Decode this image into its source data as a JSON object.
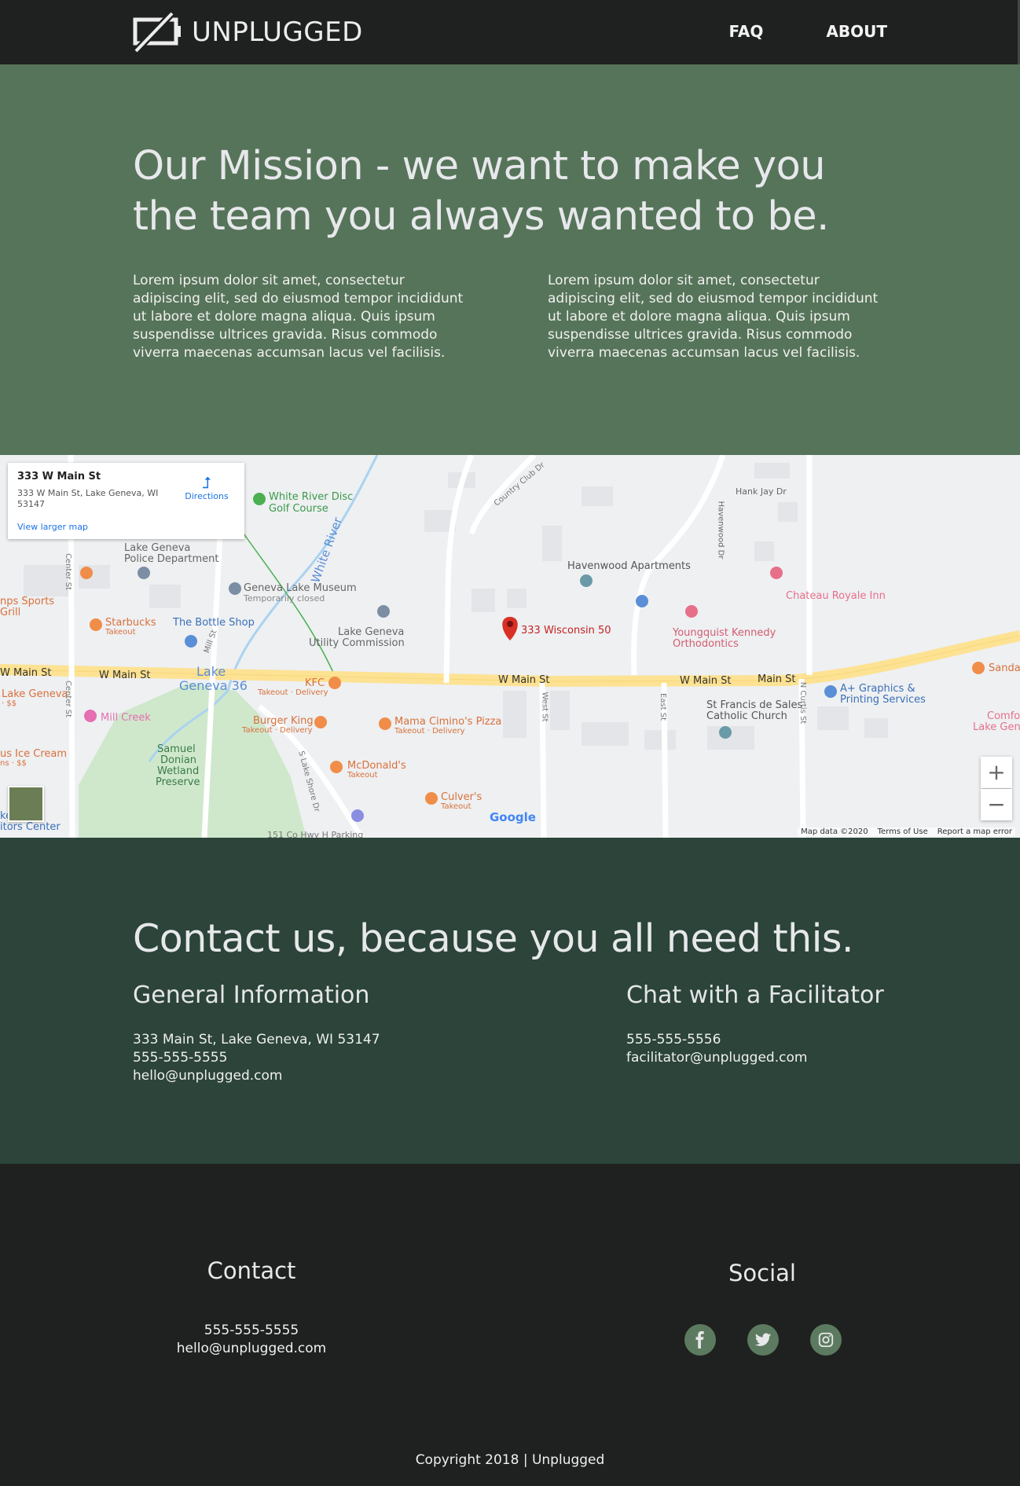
{
  "nav": {
    "brand": "UNPLUGGED",
    "links": [
      "FAQ",
      "ABOUT"
    ]
  },
  "mission": {
    "heading": "Our Mission - we want to make you the team you always wanted to be.",
    "paragraphs": [
      "Lorem ipsum dolor sit amet, consectetur adipiscing elit, sed do eiusmod tempor incididunt ut labore et dolore magna aliqua. Quis ipsum suspendisse ultrices gravida. Risus commodo viverra maecenas accumsan lacus vel facilisis.",
      "Lorem ipsum dolor sit amet, consectetur adipiscing elit, sed do eiusmod tempor incididunt ut labore et dolore magna aliqua. Quis ipsum suspendisse ultrices gravida. Risus commodo viverra maecenas accumsan lacus vel facilisis."
    ]
  },
  "map": {
    "card_title": "333 W Main St",
    "card_address": "333 W Main St, Lake Geneva, WI 53147",
    "directions": "Directions",
    "view_larger": "View larger map",
    "marker_label": "333 Wisconsin 50",
    "zoom_in": "+",
    "zoom_out": "−",
    "google": "Google",
    "footer": [
      "Map data ©2020",
      "Terms of Use",
      "Report a map error"
    ],
    "labels": {
      "white_river_disc": "White River Disc",
      "golf_course": "Golf Course",
      "country_club_dr": "Country Club Dr",
      "hank_jay_dr": "Hank Jay Dr",
      "havenwood_dr": "Havenwood Dr",
      "lake_geneva_police_1": "Lake Geneva",
      "lake_geneva_police_2": "Police Department",
      "white_river": "White River",
      "havenwood_apartments": "Havenwood Apartments",
      "chateau_royale": "Chateau Royale Inn",
      "geneva_lake_museum": "Geneva Lake Museum",
      "temporarily_closed": "Temporarily closed",
      "sports_grill_1": "nps Sports",
      "sports_grill_2": "Grill",
      "starbucks": "Starbucks",
      "takeout": "Takeout",
      "bottle_shop": "The Bottle Shop",
      "utility_1": "Lake Geneva",
      "utility_2": "Utility Commission",
      "youngquist_1": "Youngquist Kennedy",
      "youngquist_2": "Orthodontics",
      "w_main_st": "W Main St",
      "main_st": "Main St",
      "lake_geneva_36_1": "Lake",
      "lake_geneva_36_2": "Geneva 36",
      "kfc": "KFC",
      "takeout_delivery": "Takeout · Delivery",
      "sandal": "Sandal",
      "graphics_1": "A+ Graphics &",
      "graphics_2": "Printing Services",
      "lake_geneva_dollar_1": "Lake Geneva",
      "lake_geneva_dollar_2": "· $$",
      "mill_creek": "Mill Creek",
      "burger_king": "Burger King",
      "mama_cimino": "Mama Cimino's Pizza",
      "st_francis_1": "St Francis de Sales",
      "st_francis_2": "Catholic Church",
      "comfo_1": "Comfo",
      "comfo_2": "Lake Gen",
      "ice_cream_1": "us Ice Cream",
      "ice_cream_2": "ns · $$",
      "samuel_1": "Samuel",
      "samuel_2": "Donian",
      "samuel_3": "Wetland",
      "samuel_4": "Preserve",
      "mcdonalds": "McDonald's",
      "culvers": "Culver's",
      "center_st": "Center St",
      "mill_st": "Mill St",
      "lake_shore_dr": "S Lake Shore Dr",
      "west_st": "West St",
      "east_st": "East St",
      "n_curtis_st": "N Curtis St",
      "visitors_1": "ke",
      "visitors_2": "ra",
      "visitors_3": "itors Center",
      "hwy_parking": "151 Co Hwy H Parking"
    }
  },
  "contact": {
    "heading": "Contact us, because you all need this.",
    "general_title": "General Information",
    "general_lines": [
      "333 Main St, Lake Geneva, WI 53147",
      "555-555-5555",
      "hello@unplugged.com"
    ],
    "chat_title": "Chat with a Facilitator",
    "chat_lines": [
      "555-555-5556",
      "facilitator@unplugged.com"
    ]
  },
  "footer": {
    "contact_title": "Contact",
    "contact_lines": [
      "555-555-5555",
      "hello@unplugged.com"
    ],
    "social_title": "Social",
    "social_icons": [
      "facebook-icon",
      "twitter-icon",
      "instagram-icon"
    ],
    "copyright": "Copyright 2018 | Unplugged"
  },
  "colors": {
    "nav_bg": "#1f2120",
    "mission_bg": "#567459",
    "contact_bg": "#2c4439",
    "footer_bg": "#1f2120",
    "social_icon_bg": "#5c7a5f"
  }
}
